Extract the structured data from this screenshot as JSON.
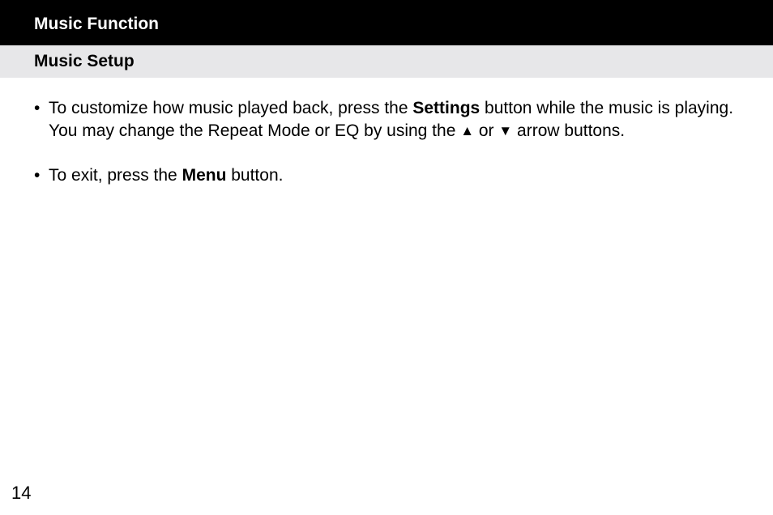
{
  "title_bar": "Music Function",
  "section_bar": "Music Setup",
  "bullets": [
    {
      "line1_pre": "To customize how music played back, press the ",
      "line1_bold": "Settings",
      "line1_post": " button while the music is playing.",
      "line2_pre": "You may change the Repeat Mode or EQ by using the ",
      "arrow_up": "▲",
      "mid": " or ",
      "arrow_down": "▼",
      "line2_post": " arrow buttons."
    },
    {
      "line1_pre": "To exit, press the ",
      "line1_bold": "Menu",
      "line1_post": " button."
    }
  ],
  "page_number": "14"
}
